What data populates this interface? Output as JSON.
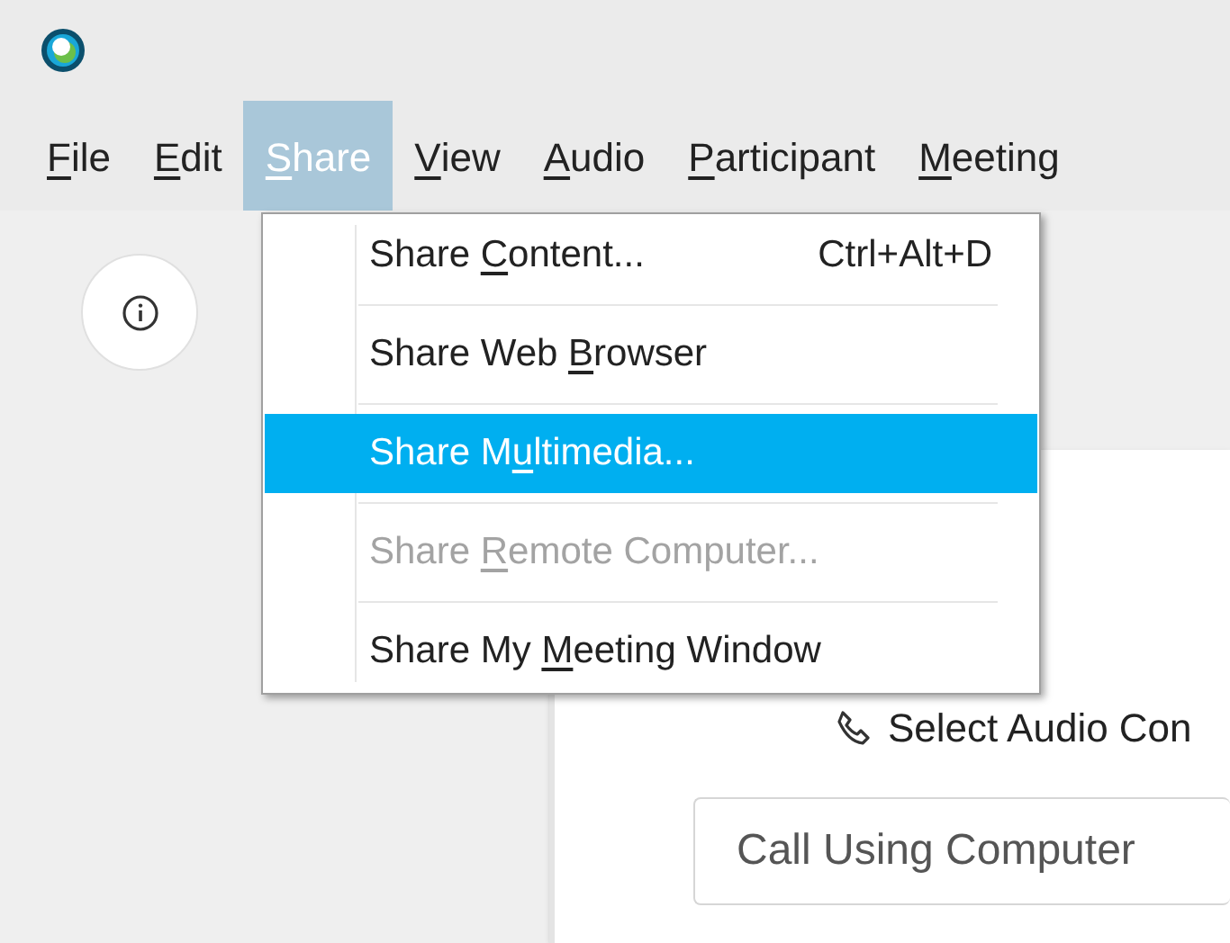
{
  "menu_bar": [
    {
      "label": {
        "key": "F",
        "after": "ile"
      },
      "selected": false
    },
    {
      "label": {
        "key": "E",
        "after": "dit"
      },
      "selected": false
    },
    {
      "label": {
        "key": "S",
        "after": "hare"
      },
      "selected": true
    },
    {
      "label": {
        "key": "V",
        "after": "iew"
      },
      "selected": false
    },
    {
      "label": {
        "key": "A",
        "after": "udio"
      },
      "selected": false
    },
    {
      "label": {
        "key": "P",
        "after": "articipant"
      },
      "selected": false
    },
    {
      "label": {
        "key": "M",
        "after": "eeting"
      },
      "selected": false
    }
  ],
  "share_menu": [
    {
      "label": {
        "before": "Share ",
        "key": "C",
        "after": "ontent..."
      },
      "shortcut": "Ctrl+Alt+D",
      "selected": false,
      "disabled": false
    },
    {
      "label": {
        "before": "Share Web ",
        "key": "B",
        "after": "rowser"
      },
      "selected": false,
      "disabled": false
    },
    {
      "label": {
        "before": "Share M",
        "key": "u",
        "after": "ltimedia..."
      },
      "selected": true,
      "disabled": false
    },
    {
      "label": {
        "before": "Share ",
        "key": "R",
        "after": "emote Computer..."
      },
      "selected": false,
      "disabled": true
    },
    {
      "label": {
        "before": "Share My ",
        "key": "M",
        "after": "eeting Window"
      },
      "selected": false,
      "disabled": false
    }
  ],
  "audio_panel": {
    "heading": "Select Audio Con",
    "button": "Call Using Computer"
  }
}
